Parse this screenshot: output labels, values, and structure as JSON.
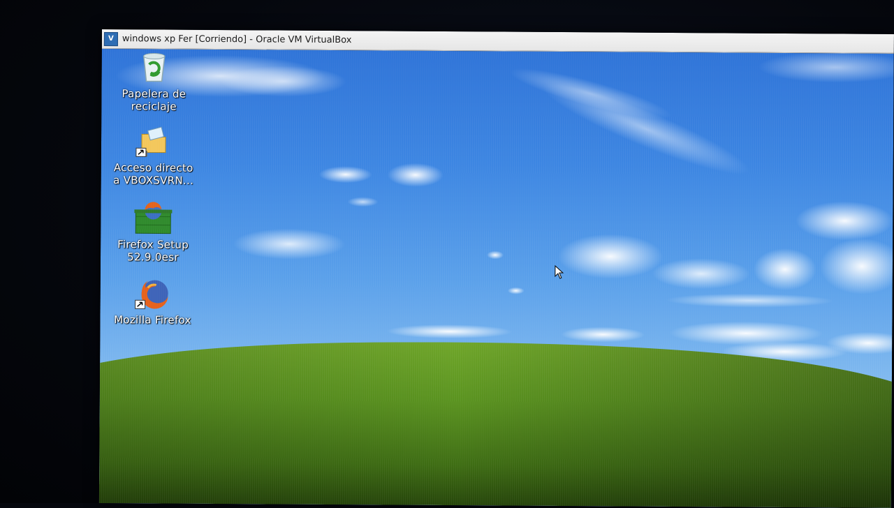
{
  "window": {
    "title": "windows xp Fer [Corriendo] - Oracle VM VirtualBox",
    "icon": "virtualbox-icon"
  },
  "desktop": {
    "icons": [
      {
        "label_line1": "Papelera de",
        "label_line2": "reciclaje",
        "icon": "recycle-bin-icon",
        "shortcut": false
      },
      {
        "label_line1": "Acceso directo",
        "label_line2": "a VBOXSVRN...",
        "icon": "network-folder-icon",
        "shortcut": true
      },
      {
        "label_line1": "Firefox Setup",
        "label_line2": "52.9.0esr",
        "icon": "firefox-setup-icon",
        "shortcut": false
      },
      {
        "label_line1": "Mozilla Firefox",
        "label_line2": "",
        "icon": "firefox-icon",
        "shortcut": true
      }
    ]
  },
  "colors": {
    "sky_top": "#2f74d8",
    "sky_bottom": "#a9d1f3",
    "hill": "#5f9a22"
  }
}
